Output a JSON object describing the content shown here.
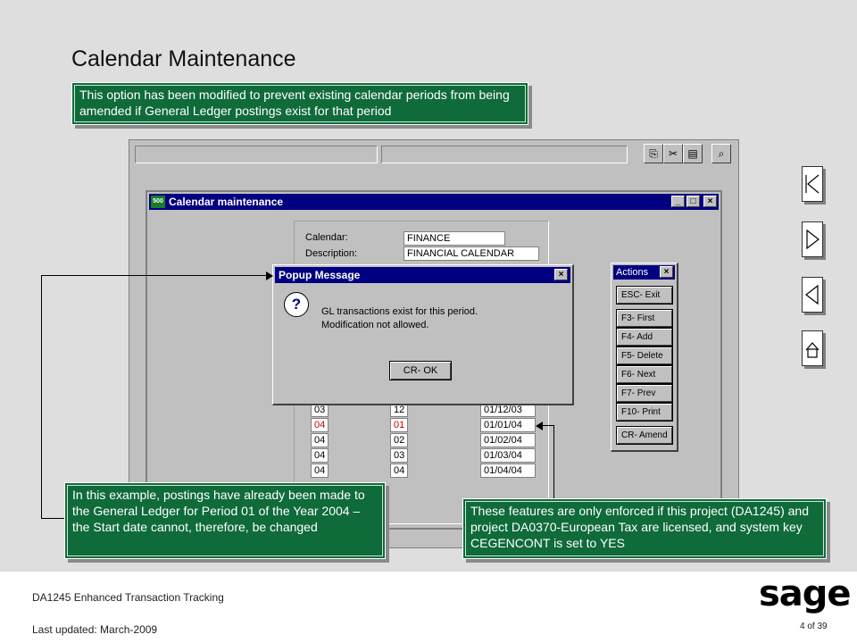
{
  "slide": {
    "title": "Calendar Maintenance",
    "note_top": "This option has been modified to prevent existing calendar periods from being amended if General Ledger postings exist for that period",
    "note_left": "In this example, postings have already been made to the General Ledger for Period 01 of the Year 2004 – the Start date cannot, therefore, be changed",
    "note_right": "These features are only enforced if this project (DA1245) and project DA0370-European Tax are licensed, and system key CEGENCONT is set to YES"
  },
  "window": {
    "title": "Calendar maintenance",
    "logo_text": "500",
    "calendar_label": "Calendar:",
    "calendar_value": "FINANCE",
    "description_label": "Description:",
    "description_value": "FINANCIAL CALENDAR"
  },
  "periods": [
    {
      "year": "03",
      "period": "12",
      "start": "01/12/03",
      "highlight": false
    },
    {
      "year": "04",
      "period": "01",
      "start": "01/01/04",
      "highlight": true
    },
    {
      "year": "04",
      "period": "02",
      "start": "01/02/04",
      "highlight": false
    },
    {
      "year": "04",
      "period": "03",
      "start": "01/03/04",
      "highlight": false
    },
    {
      "year": "04",
      "period": "04",
      "start": "01/04/04",
      "highlight": false
    }
  ],
  "popup": {
    "title": "Popup Message",
    "line1": "GL transactions exist for this period.",
    "line2": "Modification not allowed.",
    "ok_label": "CR- OK"
  },
  "actions": {
    "title": "Actions",
    "exit": "ESC- Exit",
    "items": [
      "F3- First",
      "F4- Add",
      "F5- Delete",
      "F6- Next",
      "F7- Prev",
      "F10- Print"
    ],
    "amend": "CR- Amend"
  },
  "footer": {
    "doc_title": "DA1245 Enhanced Transaction Tracking",
    "updated": "Last updated:  March-2009",
    "page": "4 of 39",
    "logo": "sage"
  }
}
